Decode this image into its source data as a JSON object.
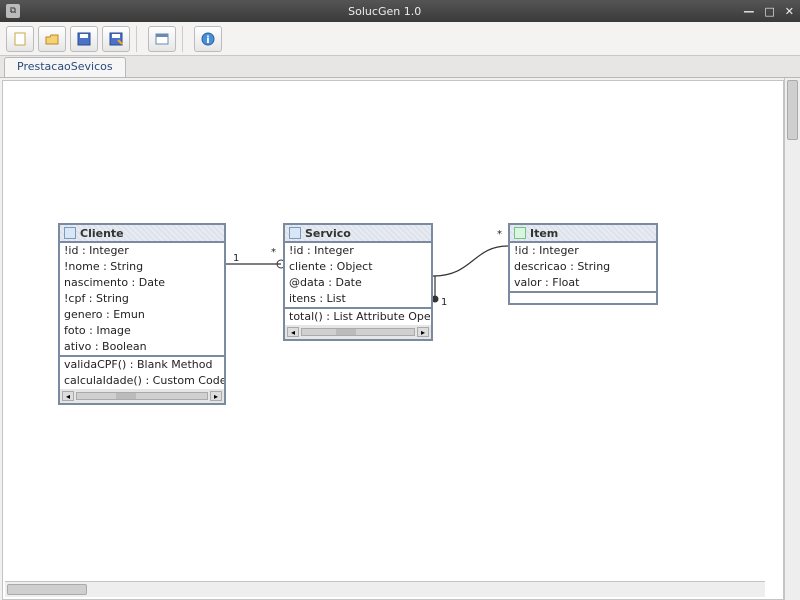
{
  "window": {
    "title": "SolucGen 1.0"
  },
  "toolbar": {
    "buttons": [
      "new",
      "open",
      "save",
      "save-as",
      "window",
      "info"
    ]
  },
  "tab": {
    "label": "PrestacaoSevicos"
  },
  "entities": {
    "cliente": {
      "title": "Cliente",
      "attrs": [
        "!id : Integer",
        "!nome : String",
        "nascimento : Date",
        "!cpf : String",
        "genero : Emun",
        "foto : Image",
        "ativo : Boolean"
      ],
      "ops": [
        "validaCPF() : Blank Method",
        "calculaIdade() : Custom Code"
      ]
    },
    "servico": {
      "title": "Servico",
      "attrs": [
        "!id : Integer",
        "cliente : Object",
        "@data : Date",
        "itens : List"
      ],
      "ops": [
        "total() : List Attribute Operation"
      ]
    },
    "item": {
      "title": "Item",
      "attrs": [
        "!id : Integer",
        "descricao : String",
        "valor : Float"
      ]
    }
  },
  "relations": {
    "cliente_servico": {
      "left_mult": "1",
      "right_mult": "*"
    },
    "servico_item": {
      "left_mult": "1",
      "right_mult": "*"
    }
  }
}
